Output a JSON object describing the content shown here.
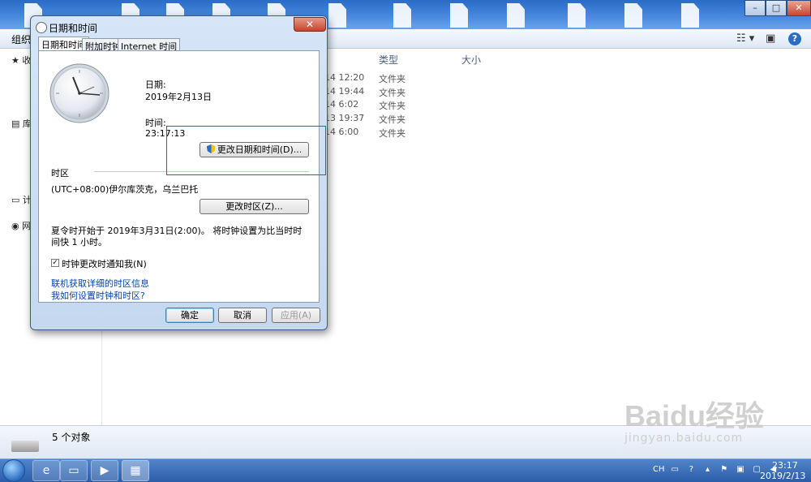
{
  "explorer": {
    "toolbar": {
      "organize": "组织"
    },
    "nav": [
      "收",
      "库",
      "计",
      "网"
    ],
    "columns": {
      "type": "类型",
      "size": "大小"
    },
    "files": [
      {
        "time": "14 12:20",
        "type": "文件夹"
      },
      {
        "time": "14 19:44",
        "type": "文件夹"
      },
      {
        "time": "14 6:02",
        "type": "文件夹"
      },
      {
        "time": "13 19:37",
        "type": "文件夹"
      },
      {
        "time": "14 6:00",
        "type": "文件夹"
      }
    ],
    "status": "5 个对象"
  },
  "watermark": {
    "logo": "Baidu经验",
    "url": "jingyan.baidu.com"
  },
  "dialog": {
    "title": "日期和时间",
    "close": "✕",
    "tabs": [
      "日期和时间",
      "附加时钟",
      "Internet 时间"
    ],
    "date_label": "日期:",
    "date_value": "2019年2月13日",
    "time_label": "时间:",
    "time_value": "23:17:13",
    "change_datetime_btn": "更改日期和时间(D)...",
    "tz_header": "时区",
    "tz_value": "(UTC+08:00)伊尔库茨克，乌兰巴托",
    "change_tz_btn": "更改时区(Z)...",
    "dst_text": "夏令时开始于 2019年3月31日(2:00)。 将时钟设置为比当时时间快 1 小时。",
    "notify_label": "时钟更改时通知我(N)",
    "notify_checked": true,
    "link_online": "联机获取详细的时区信息",
    "link_howto": "我如何设置时钟和时区?",
    "ok": "确定",
    "cancel": "取消",
    "apply": "应用(A)"
  },
  "taskbar": {
    "clock_time": "23:17",
    "clock_date": "2019/2/13",
    "tray_lang": "CH"
  },
  "colors": {
    "highlight": "#d4282f",
    "link": "#0645ad",
    "taskbar": "#2d5da8"
  }
}
